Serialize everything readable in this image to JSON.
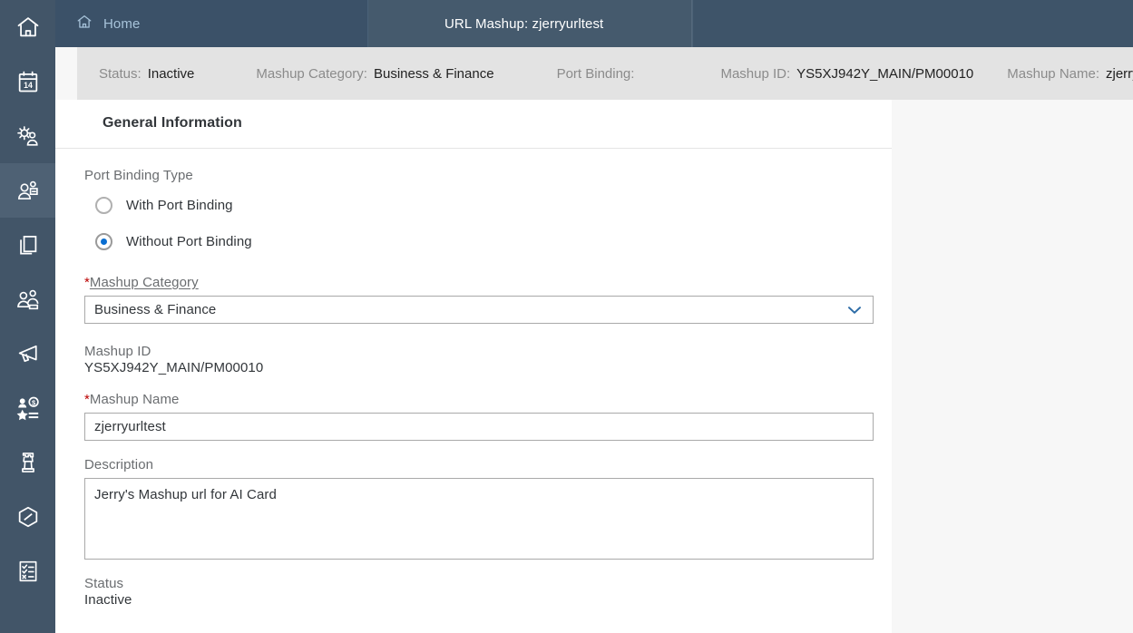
{
  "sidebar": {
    "items": [
      {
        "name": "home-icon",
        "label": "Home",
        "selected": false
      },
      {
        "name": "calendar-icon",
        "label": "Calendar",
        "selected": false
      },
      {
        "name": "user-settings-icon",
        "label": "User Settings",
        "selected": false
      },
      {
        "name": "people-icon",
        "label": "People",
        "selected": true
      },
      {
        "name": "copy-icon",
        "label": "Copy",
        "selected": false
      },
      {
        "name": "group-icon",
        "label": "Group",
        "selected": false
      },
      {
        "name": "megaphone-icon",
        "label": "Announcements",
        "selected": false
      },
      {
        "name": "compensation-icon",
        "label": "Compensation",
        "selected": false
      },
      {
        "name": "rook-icon",
        "label": "Succession",
        "selected": false
      },
      {
        "name": "cube-icon",
        "label": "Objects",
        "selected": false
      },
      {
        "name": "checklist-icon",
        "label": "Checklist",
        "selected": false
      }
    ]
  },
  "tabs": {
    "home": {
      "label": "Home",
      "icon": "home-icon"
    },
    "mashup": {
      "label": "URL Mashup: zjerryurltest",
      "close_icon": "close-icon"
    }
  },
  "object_header": {
    "fields": [
      {
        "label": "Status:",
        "value": "Inactive"
      },
      {
        "label": "Mashup Category:",
        "value": "Business & Finance"
      },
      {
        "label": "Port Binding:",
        "value": ""
      },
      {
        "label": "Mashup ID:",
        "value": "YS5XJ942Y_MAIN/PM00010"
      },
      {
        "label": "Mashup Name:",
        "value": "zjerryurltest"
      }
    ]
  },
  "section": {
    "title": "General Information"
  },
  "form": {
    "port_binding_type": {
      "label": "Port Binding Type",
      "options": [
        {
          "label": "With Port Binding",
          "checked": false
        },
        {
          "label": "Without Port Binding",
          "checked": true
        }
      ]
    },
    "mashup_category": {
      "required_marker": "*",
      "label": "Mashup Category",
      "value": "Business & Finance",
      "chevron_icon": "chevron-down-icon"
    },
    "mashup_id": {
      "label": "Mashup ID",
      "value": "YS5XJ942Y_MAIN/PM00010"
    },
    "mashup_name": {
      "required_marker": "*",
      "label": "Mashup Name",
      "value": "zjerryurltest"
    },
    "description": {
      "label": "Description",
      "value": "Jerry's Mashup url for AI Card"
    },
    "status": {
      "label": "Status",
      "value": "Inactive"
    }
  },
  "colors": {
    "sidebar_bg": "#425568",
    "sidebar_selected": "#4e6174",
    "tabbar_bg": "#3b5168",
    "tab_active_bg": "#455a6d",
    "object_header_bg": "#e3e3e3",
    "accent_blue": "#0a6ed1",
    "required_red": "#bb0000",
    "title_navy": "#32363a",
    "page_bg": "#f7f7f7"
  }
}
